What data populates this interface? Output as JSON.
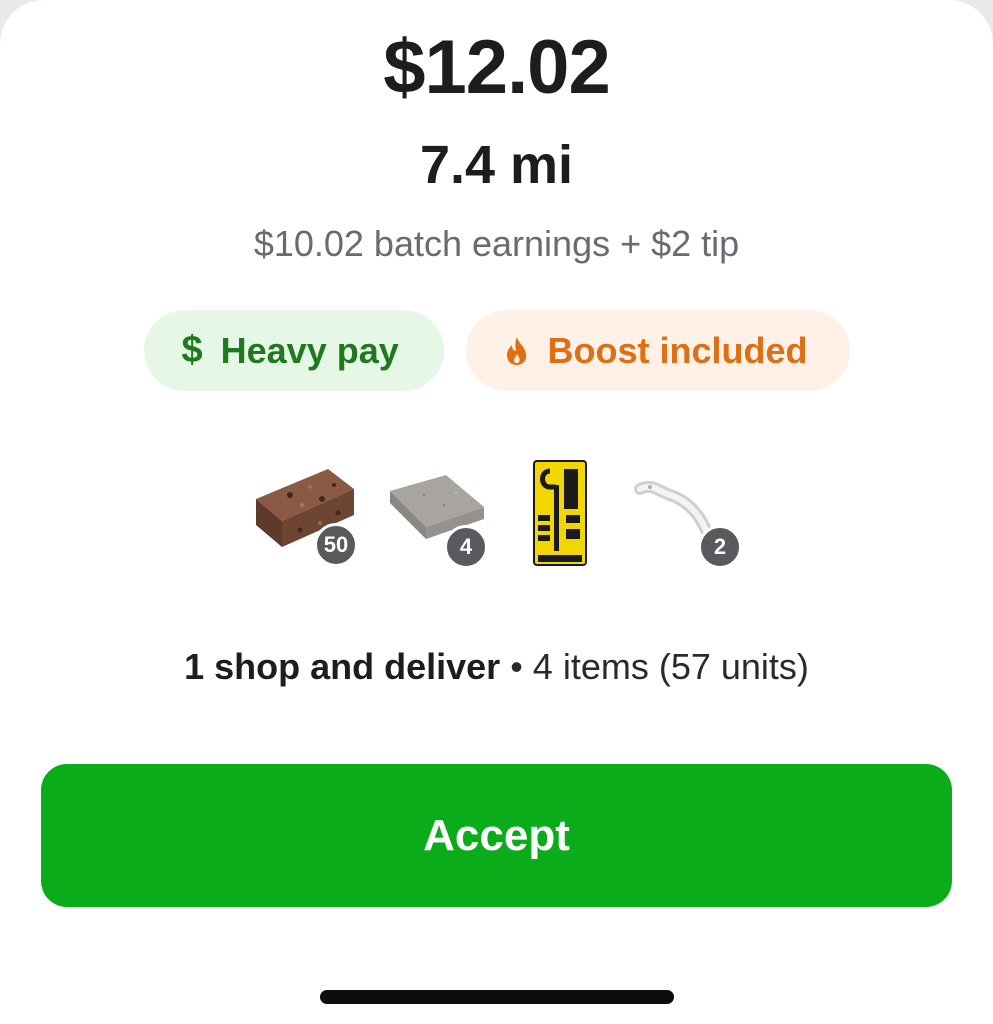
{
  "offer": {
    "price": "$12.02",
    "distance": "7.4 mi",
    "earnings_breakdown": "$10.02 batch earnings + $2 tip"
  },
  "badges": [
    {
      "label": "Heavy pay",
      "icon": "dollar-icon",
      "color": "#1f7a1f",
      "background": "#e6f7e5"
    },
    {
      "label": "Boost included",
      "icon": "flame-icon",
      "color": "#e06f14",
      "background": "#fdf1e8"
    }
  ],
  "items": [
    {
      "icon": "paver-brick-icon",
      "count": "50"
    },
    {
      "icon": "concrete-tile-icon",
      "count": "4"
    },
    {
      "icon": "ceiling-hook-package-icon",
      "count": ""
    },
    {
      "icon": "door-pull-handle-icon",
      "count": "2"
    }
  ],
  "summary": {
    "type": "1 shop and deliver",
    "separator": "•",
    "details": "4 items (57 units)"
  },
  "accept_button": {
    "label": "Accept",
    "color": "#0aad19"
  }
}
